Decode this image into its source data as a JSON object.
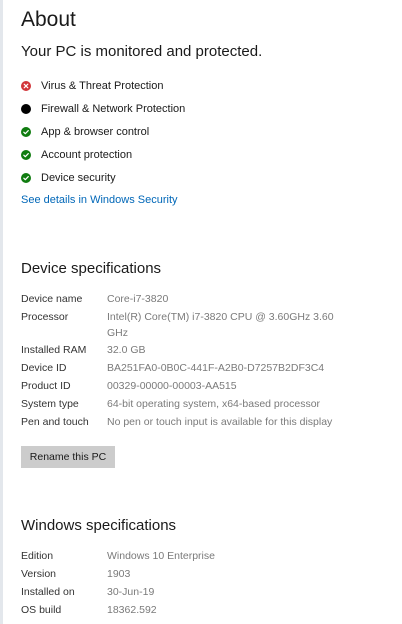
{
  "title": "About",
  "security": {
    "heading": "Your PC is monitored and protected.",
    "items": [
      {
        "label": "Virus & Threat Protection",
        "status": "error",
        "color": "#d13438"
      },
      {
        "label": "Firewall & Network Protection",
        "status": "unknown",
        "color": "#000000"
      },
      {
        "label": "App & browser control",
        "status": "ok",
        "color": "#107c10"
      },
      {
        "label": "Account protection",
        "status": "ok",
        "color": "#107c10"
      },
      {
        "label": "Device security",
        "status": "ok",
        "color": "#107c10"
      }
    ],
    "details_link": "See details in Windows Security",
    "link_color": "#0067b8"
  },
  "device_specs": {
    "title": "Device specifications",
    "rows": [
      {
        "label": "Device name",
        "value": "Core-i7-3820"
      },
      {
        "label": "Processor",
        "value": "Intel(R) Core(TM) i7-3820 CPU @ 3.60GHz   3.60 GHz"
      },
      {
        "label": "Installed RAM",
        "value": "32.0 GB"
      },
      {
        "label": "Device ID",
        "value": "BA251FA0-0B0C-441F-A2B0-D7257B2DF3C4"
      },
      {
        "label": "Product ID",
        "value": "00329-00000-00003-AA515"
      },
      {
        "label": "System type",
        "value": "64-bit operating system, x64-based processor"
      },
      {
        "label": "Pen and touch",
        "value": "No pen or touch input is available for this display"
      }
    ],
    "rename_button": "Rename this PC"
  },
  "windows_specs": {
    "title": "Windows specifications",
    "rows": [
      {
        "label": "Edition",
        "value": "Windows 10 Enterprise"
      },
      {
        "label": "Version",
        "value": "1903"
      },
      {
        "label": "Installed on",
        "value": "30-Jun-19"
      },
      {
        "label": "OS build",
        "value": "18362.592"
      }
    ]
  }
}
